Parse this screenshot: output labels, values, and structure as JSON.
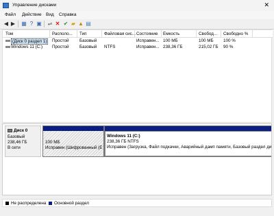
{
  "window": {
    "title": "Управление дисками",
    "close_glyph": "✕"
  },
  "menu": [
    "Файл",
    "Действие",
    "Вид",
    "Справка"
  ],
  "toolbar": {
    "icons": [
      "back-icon",
      "forward-icon",
      "grid-icon",
      "help-icon",
      "properties-icon",
      "delete-icon",
      "check-icon",
      "folder-icon",
      "up-icon",
      "new-icon"
    ]
  },
  "table": {
    "columns": [
      "Том",
      "Располо...",
      "Тип",
      "Файловая сис...",
      "Состояние",
      "Емкость",
      "Свобод...",
      "Свободно %"
    ],
    "rows": [
      [
        "(Диск 0 раздел 1)",
        "Простой",
        "Базовый",
        "",
        "Исправен...",
        "100 МБ",
        "100 МБ",
        "100 %"
      ],
      [
        "Windows 11 (C:)",
        "Простой",
        "Базовый",
        "NTFS",
        "Исправен...",
        "238,36 ГБ",
        "215,02 ГБ",
        "90 %"
      ]
    ]
  },
  "disk": {
    "name": "Диск 0",
    "type": "Базовый",
    "size": "238,46 ГБ",
    "status": "В сети",
    "partitions": [
      {
        "title": "",
        "size": "100 МБ",
        "status": "Исправен (Шифрованный (E"
      },
      {
        "title": "Windows 11 (C:)",
        "size": "238,36 ГБ NTFS",
        "status": "Исправен (Загрузка, Файл подкачки, Аварийный дамп памяти, Базовый раздел ди"
      }
    ]
  },
  "legend": [
    {
      "label": "Не распределена",
      "color": "#000000"
    },
    {
      "label": "Основной раздел",
      "color": "#0a1f7f"
    }
  ]
}
